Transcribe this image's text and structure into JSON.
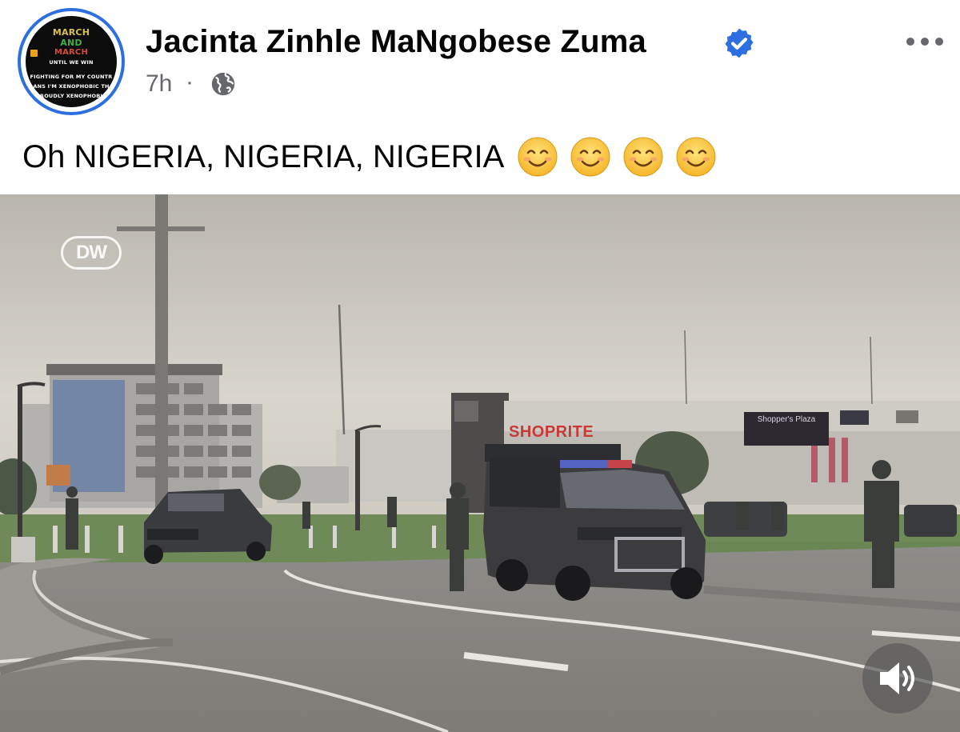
{
  "post": {
    "author": "Jacinta Zinhle MaNgobese Zuma",
    "time": "7h",
    "separator": "·",
    "privacy_icon": "globe-icon",
    "verified_icon": "verified-badge-icon",
    "more_icon": "more-options-icon",
    "text": "Oh NIGERIA, NIGERIA, NIGERIA",
    "emojis": [
      "smiling-face-emoji",
      "smiling-face-emoji",
      "smiling-face-emoji",
      "smiling-face-emoji"
    ]
  },
  "avatar": {
    "lines": [
      "MARCH",
      "AND",
      "MARCH",
      "UNTIL WE WIN",
      "FIGHTING FOR MY COUNTR",
      "ANS I'M XENOPHOBIC TH",
      "ROUDLY XENOPHOBI"
    ]
  },
  "video": {
    "watermark": "DW",
    "signs": {
      "shoprite": "SHOPRITE",
      "store": "Shopper's Plaza"
    },
    "sound_icon": "speaker-icon"
  },
  "colors": {
    "verified_blue": "#2d6fe0",
    "avatar_ring": "#2d6fe0",
    "text_primary": "#050505",
    "text_secondary": "#65676b"
  }
}
